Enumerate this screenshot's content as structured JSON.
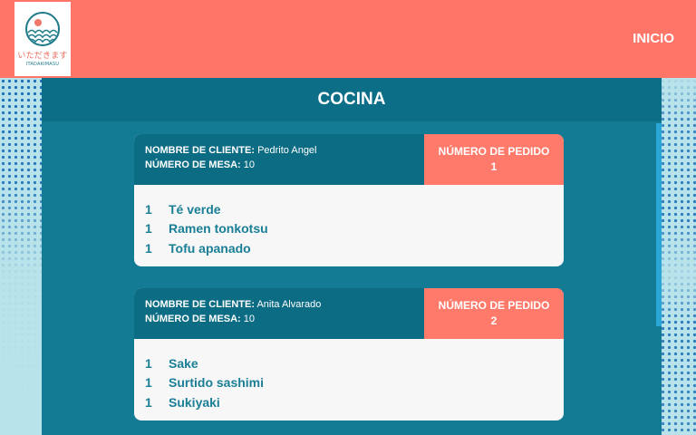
{
  "logo": {
    "jp_text": "いただきます",
    "romaji": "ITADAKIMASU",
    "icon": "wave-sun-logo-icon"
  },
  "nav": {
    "home_label": "INICIO"
  },
  "page": {
    "title": "COCINA"
  },
  "labels": {
    "client": "NOMBRE DE CLIENTE:",
    "table": "NÚMERO DE MESA:",
    "order_number": "NÚMERO DE PEDIDO"
  },
  "orders": [
    {
      "client": "Pedrito Angel",
      "table": "10",
      "number": "1",
      "items": [
        {
          "qty": "1",
          "name": "Té verde"
        },
        {
          "qty": "1",
          "name": "Ramen tonkotsu"
        },
        {
          "qty": "1",
          "name": "Tofu apanado"
        }
      ]
    },
    {
      "client": "Anita Alvarado",
      "table": "10",
      "number": "2",
      "items": [
        {
          "qty": "1",
          "name": "Sake"
        },
        {
          "qty": "1",
          "name": "Surtido sashimi"
        },
        {
          "qty": "1",
          "name": "Sukiyaki"
        }
      ]
    }
  ],
  "colors": {
    "header": "#ff7668",
    "panel": "#137b93",
    "card_head": "#0c6c84",
    "accent": "#ff7a6a",
    "item_text": "#1a7f96"
  }
}
